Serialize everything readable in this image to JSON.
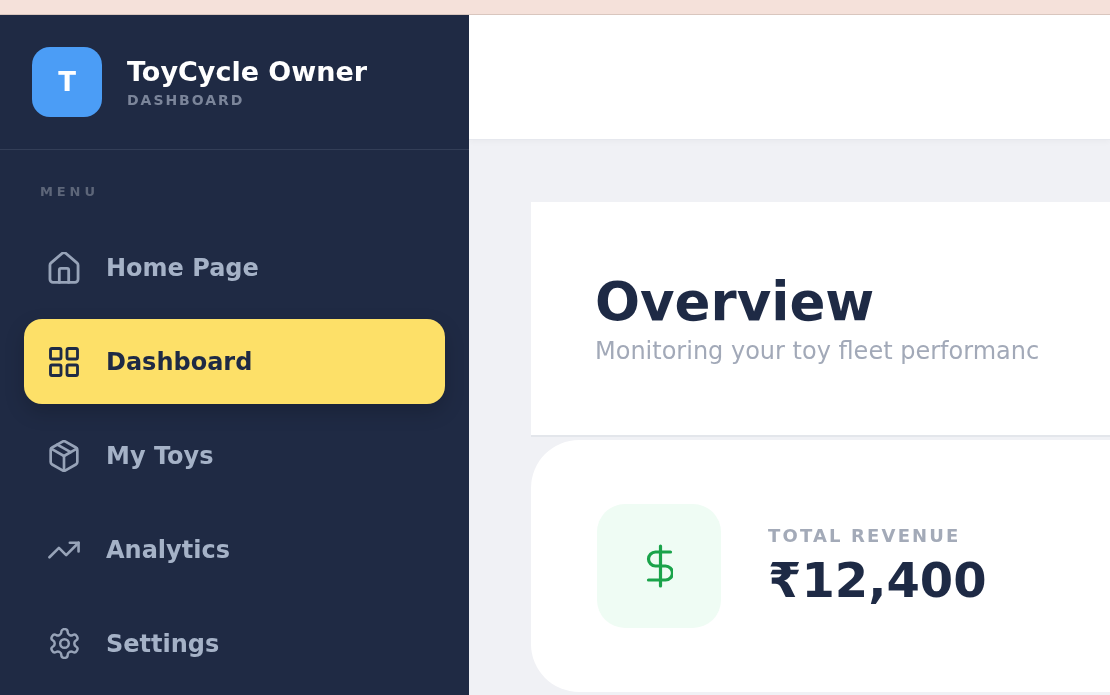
{
  "sidebar": {
    "logo_letter": "T",
    "title": "ToyCycle Owner",
    "subtitle": "DASHBOARD",
    "section_label": "MENU",
    "items": [
      {
        "label": "Home Page",
        "selected": false
      },
      {
        "label": "Dashboard",
        "selected": true
      },
      {
        "label": "My Toys",
        "selected": false
      },
      {
        "label": "Analytics",
        "selected": false
      },
      {
        "label": "Settings",
        "selected": false
      }
    ]
  },
  "overview": {
    "title": "Overview",
    "subtitle": "Monitoring your toy fleet performanc"
  },
  "stats": [
    {
      "label": "TOTAL REVENUE",
      "value": "₹12,400"
    }
  ]
}
